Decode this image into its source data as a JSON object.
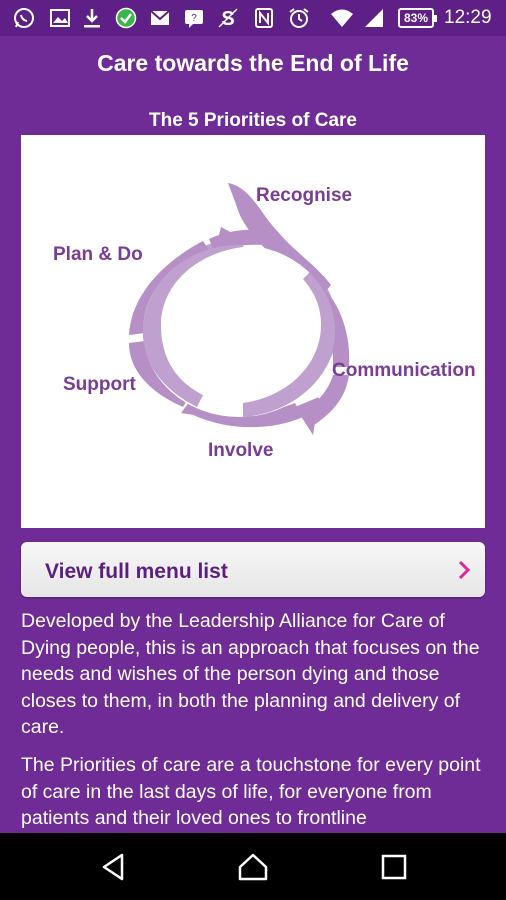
{
  "status_bar": {
    "battery": "83%",
    "time": "12:29",
    "icons": [
      "whatsapp-icon",
      "gallery-icon",
      "download-icon",
      "check-circle-icon",
      "mail-icon",
      "chat-icon",
      "s-app-icon",
      "nfc-icon",
      "alarm-icon",
      "wifi-icon",
      "signal-icon",
      "battery-icon"
    ]
  },
  "header": {
    "title": "Care towards the End of Life"
  },
  "diagram": {
    "title": "The 5 Priorities of Care",
    "labels": {
      "recognise": "Recognise",
      "communication": "Communication",
      "involve": "Involve",
      "support": "Support",
      "plan_do": "Plan & Do"
    },
    "colors": {
      "arrow": "#b58fc6",
      "text": "#7b3c96"
    }
  },
  "menu_button": {
    "label": "View full menu list",
    "chevron_color": "#e0249a"
  },
  "content": {
    "p1": "Developed by the Leadership Alliance for Care of Dying people, this is an approach that focuses on the needs and wishes of the person dying and those closes to them, in both the planning and delivery of care.",
    "p2": "The Priorities of care are a touchstone for every point of care in the last days of life, for everyone from patients and their loved ones to frontline"
  },
  "nav": {
    "icons": [
      "back-icon",
      "home-icon",
      "recents-icon"
    ]
  },
  "colors": {
    "background": "#6f2c96",
    "status_bar": "#5e1f86"
  }
}
